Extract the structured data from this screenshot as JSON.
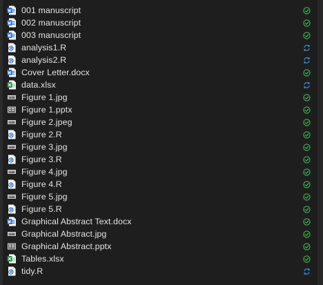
{
  "files": [
    {
      "name": "001 manuscript",
      "type": "docx",
      "status": "synced"
    },
    {
      "name": "002 manuscript",
      "type": "docx",
      "status": "synced"
    },
    {
      "name": "003 manuscript",
      "type": "docx",
      "status": "synced"
    },
    {
      "name": "analysis1.R",
      "type": "r",
      "status": "syncing"
    },
    {
      "name": "analysis2.R",
      "type": "r",
      "status": "syncing"
    },
    {
      "name": "Cover Letter.docx",
      "type": "docx",
      "status": "synced"
    },
    {
      "name": "data.xlsx",
      "type": "xlsx",
      "status": "syncing"
    },
    {
      "name": "Figure 1.jpg",
      "type": "image",
      "status": "synced"
    },
    {
      "name": "Figure 1.pptx",
      "type": "pptx",
      "status": "synced"
    },
    {
      "name": "Figure 2.jpeg",
      "type": "image",
      "status": "synced"
    },
    {
      "name": "Figure 2.R",
      "type": "r",
      "status": "synced"
    },
    {
      "name": "Figure 3.jpg",
      "type": "image",
      "status": "synced"
    },
    {
      "name": "Figure 3.R",
      "type": "r",
      "status": "synced"
    },
    {
      "name": "Figure 4.jpg",
      "type": "image",
      "status": "synced"
    },
    {
      "name": "Figure 4.R",
      "type": "r",
      "status": "synced"
    },
    {
      "name": "Figure 5.jpg",
      "type": "image",
      "status": "synced"
    },
    {
      "name": "Figure 5.R",
      "type": "r",
      "status": "synced"
    },
    {
      "name": "Graphical Abstract Text.docx",
      "type": "docx",
      "status": "synced"
    },
    {
      "name": "Graphical Abstract.jpg",
      "type": "image",
      "status": "synced"
    },
    {
      "name": "Graphical Abstract.pptx",
      "type": "pptx",
      "status": "synced"
    },
    {
      "name": "Tables.xlsx",
      "type": "xlsx",
      "status": "synced"
    },
    {
      "name": "tidy.R",
      "type": "r",
      "status": "syncing"
    }
  ],
  "icons": {
    "docx": "word-document-icon",
    "r": "r-script-icon",
    "xlsx": "excel-spreadsheet-icon",
    "image": "image-file-icon",
    "pptx": "presentation-file-icon",
    "synced": "sync-complete-checkmark-icon",
    "syncing": "sync-in-progress-icon"
  },
  "colors": {
    "background": "#1e1e1e",
    "text": "#e4e4e4",
    "word_blue": "#2b6fd6",
    "excel_green": "#1e8a47",
    "synced_green": "#3fb950",
    "syncing_blue": "#3b8fd9"
  }
}
